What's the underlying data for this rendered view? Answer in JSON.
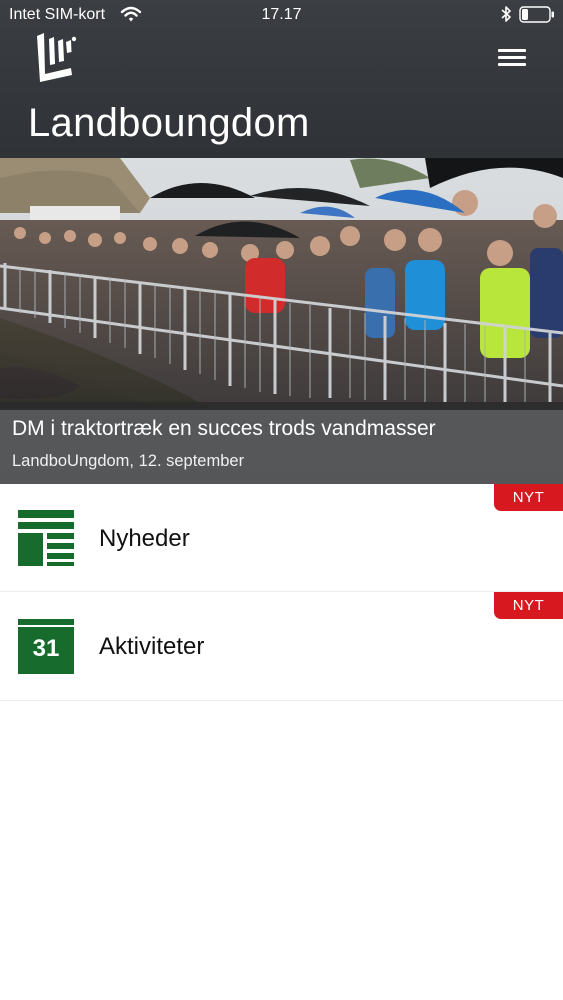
{
  "status_bar": {
    "carrier": "Intet SIM-kort",
    "time": "17.17"
  },
  "header": {
    "title": "Landboungdom",
    "logo_icon": "landboungdom-logo",
    "menu_icon": "hamburger-menu-icon"
  },
  "featured_article": {
    "title": "DM i traktortræk en succes trods vandmasser",
    "meta": "LandboUngdom, 12. september"
  },
  "menu_items": [
    {
      "label": "Nyheder",
      "badge": "NYT",
      "icon": "news-icon"
    },
    {
      "label": "Aktiviteter",
      "badge": "NYT",
      "icon": "calendar-icon",
      "calendar_day": "31"
    }
  ],
  "colors": {
    "header_bg": "#34373c",
    "brand_green": "#176b2c",
    "badge_red": "#d7191f"
  }
}
